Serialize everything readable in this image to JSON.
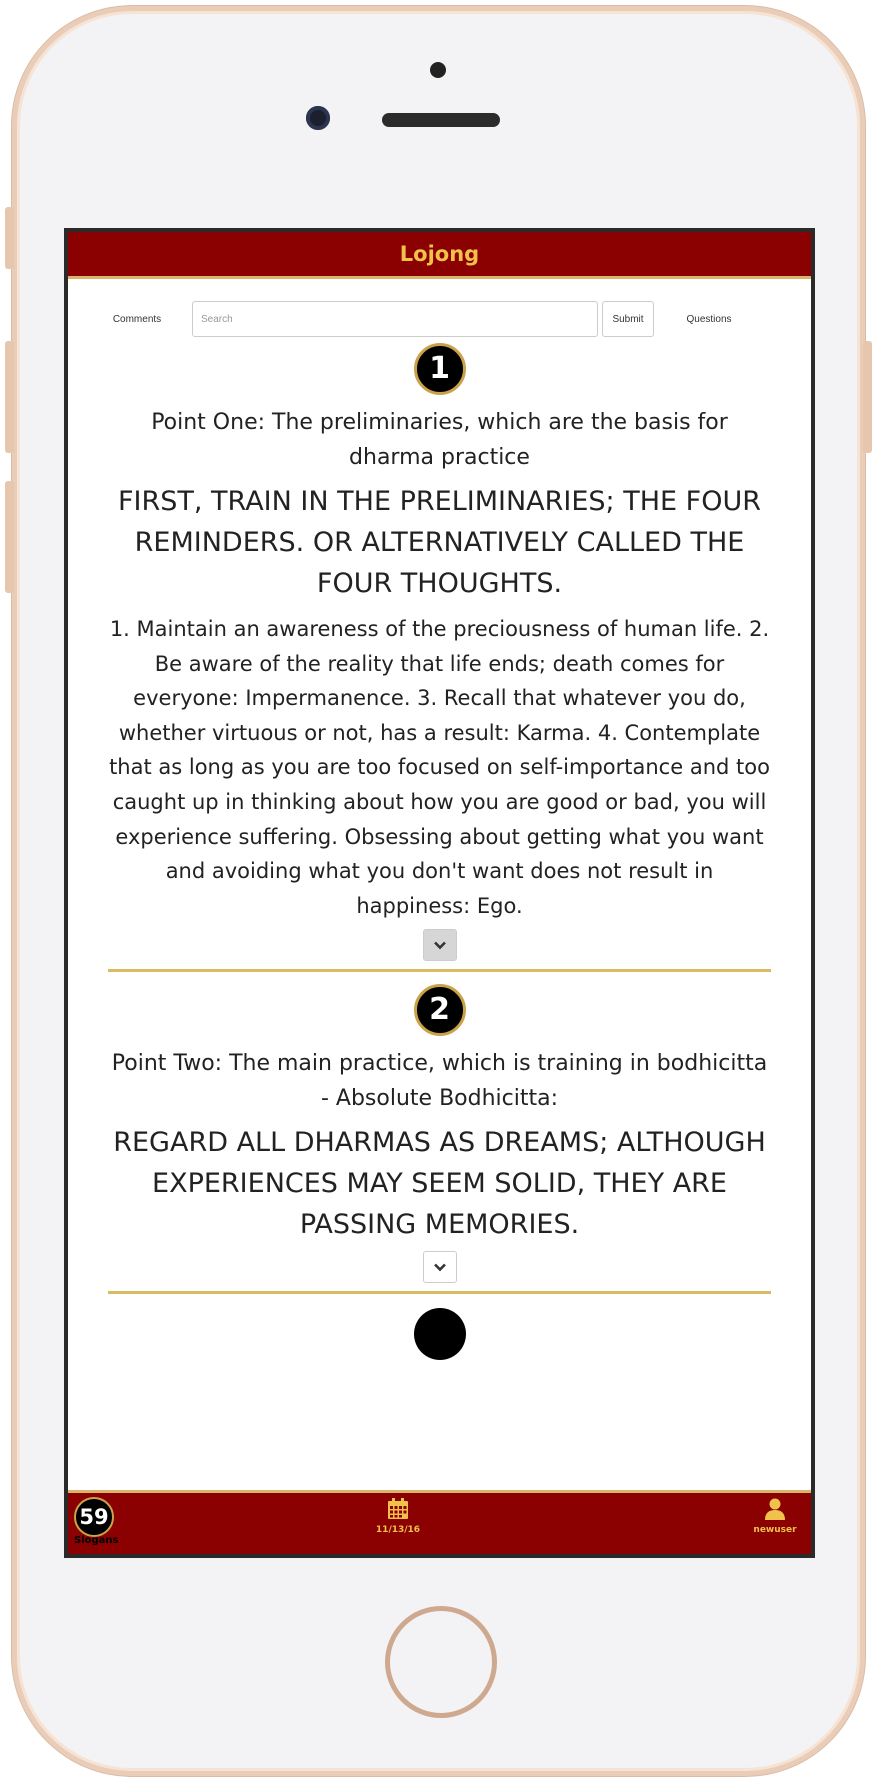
{
  "app": {
    "title": "Lojong"
  },
  "search": {
    "comments_label": "Comments",
    "placeholder": "Search",
    "submit_label": "Submit",
    "questions_label": "Questions"
  },
  "slogans": [
    {
      "number": "1",
      "point": "Point One: The preliminaries, which are the basis for dharma practice",
      "heading": "FIRST, TRAIN IN THE PRELIMINARIES; THE FOUR REMINDERS. OR ALTERNATIVELY CALLED THE FOUR THOUGHTS.",
      "description": "1. Maintain an awareness of the preciousness of human life. 2. Be aware of the reality that life ends; death comes for everyone: Impermanence. 3. Recall that whatever you do, whether virtuous or not, has a result: Karma. 4. Contemplate that as long as you are too focused on self-importance and too caught up in thinking about how you are good or bad, you will experience suffering. Obsessing about getting what you want and avoiding what you don't want does not result in happiness: Ego."
    },
    {
      "number": "2",
      "point": "Point Two: The main practice, which is training in bodhicitta - Absolute Bodhicitta:",
      "heading": "REGARD ALL DHARMAS AS DREAMS; ALTHOUGH EXPERIENCES MAY SEEM SOLID, THEY ARE PASSING MEMORIES."
    }
  ],
  "bottom_nav": {
    "slogans_count": "59",
    "slogans_label": "Slogans",
    "date_label": "11/13/16",
    "user_label": "newuser"
  },
  "colors": {
    "brand_red": "#8b0000",
    "gold": "#f0c24b",
    "divider_gold": "#d9bb62"
  },
  "icons": [
    "chevron-down-icon",
    "calendar-icon",
    "user-icon"
  ]
}
